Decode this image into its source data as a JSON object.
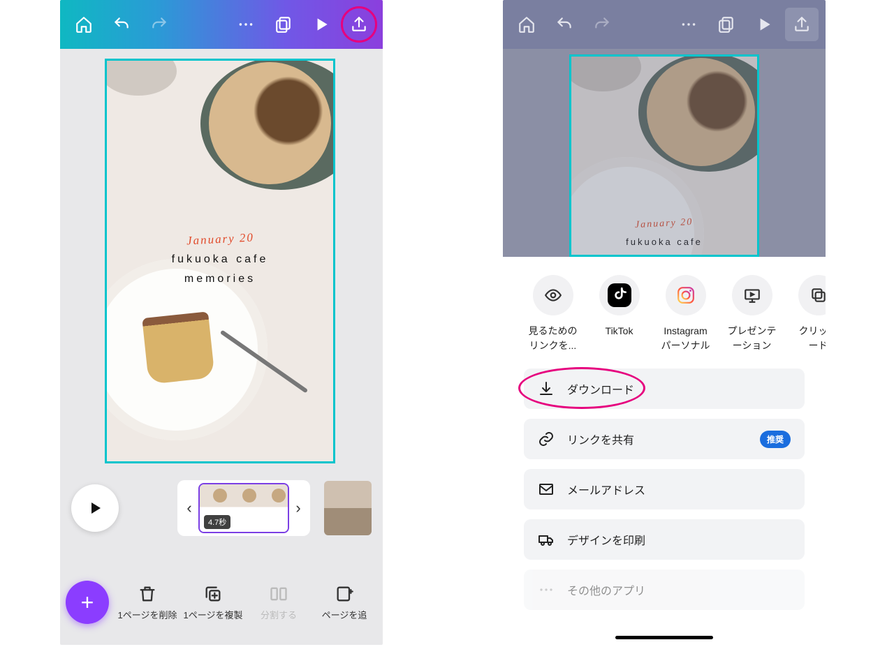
{
  "canvas": {
    "date_text": "January 20",
    "line1": "fukuoka cafe",
    "line2": "memories"
  },
  "timeline": {
    "duration_badge": "4.7秒"
  },
  "bottom_actions": {
    "delete": "1ページを削除",
    "duplicate": "1ページを複製",
    "split": "分割する",
    "addpage": "ページを追"
  },
  "share_targets": {
    "viewlink_l1": "見るための",
    "viewlink_l2": "リンクを...",
    "tiktok": "TikTok",
    "instagram_l1": "Instagram",
    "instagram_l2": "パーソナル",
    "present_l1": "プレゼンテ",
    "present_l2": "ーション",
    "clipboard_l1": "クリップ",
    "clipboard_l2": "ード"
  },
  "options": {
    "download": "ダウンロード",
    "sharelink": "リンクを共有",
    "recommended_badge": "推奨",
    "email": "メールアドレス",
    "print": "デザインを印刷",
    "other": "その他のアプリ"
  }
}
